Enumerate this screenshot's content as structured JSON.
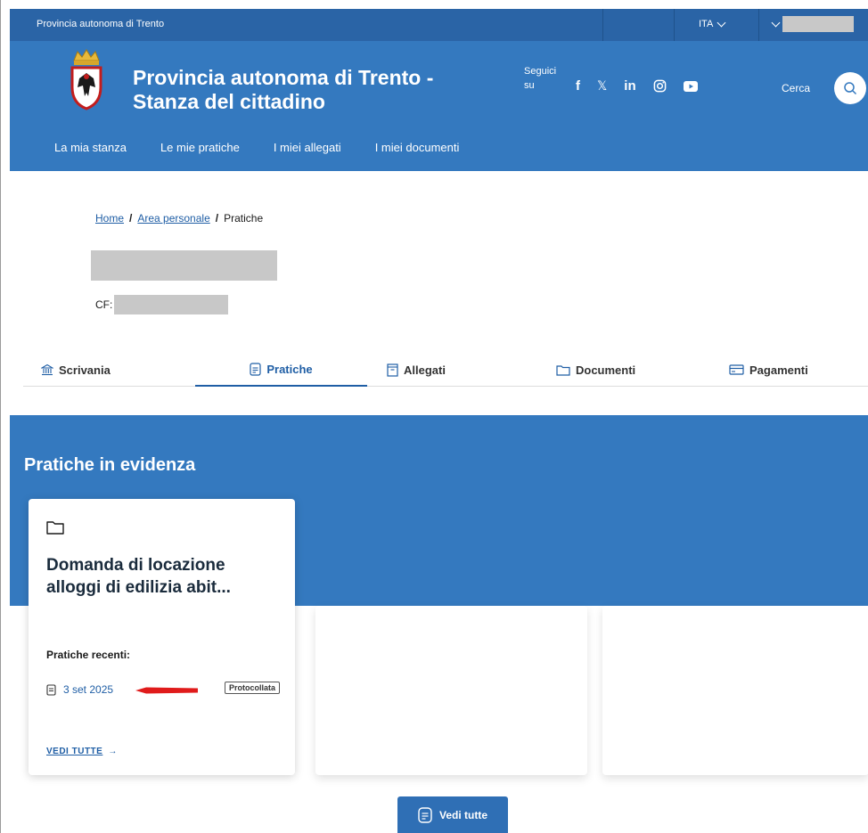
{
  "topbar": {
    "institution": "Provincia autonoma di Trento",
    "language": "ITA"
  },
  "header": {
    "title_line1": "Provincia autonoma di Trento -",
    "title_line2": "Stanza del cittadino",
    "follow_line1": "Seguici",
    "follow_line2": "su",
    "social": [
      "f",
      "𝕏",
      "in"
    ],
    "search_label": "Cerca"
  },
  "nav": {
    "items": [
      "La mia stanza",
      "Le mie pratiche",
      "I miei allegati",
      "I miei documenti"
    ]
  },
  "breadcrumb": {
    "home": "Home",
    "personal_area": "Area personale",
    "current": "Pratiche"
  },
  "profile": {
    "cf_label": "CF:"
  },
  "tabs": [
    "Scrivania",
    "Pratiche",
    "Allegati",
    "Documenti",
    "Pagamenti"
  ],
  "featured": {
    "title": "Pratiche in evidenza",
    "card": {
      "title_line1": "Domanda di locazione",
      "title_line2": "alloggi di edilizia abit...",
      "recent_label": "Pratiche recenti:",
      "recent_date": "3 set 2025",
      "status": "Protocollata",
      "see_all": "VEDI TUTTE"
    }
  },
  "see_all_button": "Vedi tutte",
  "colors": {
    "brand_blue": "#3479bf",
    "dark_blue": "#2a64a6",
    "link_blue": "#1f5ea5",
    "annotation_red": "#e01b1b"
  }
}
